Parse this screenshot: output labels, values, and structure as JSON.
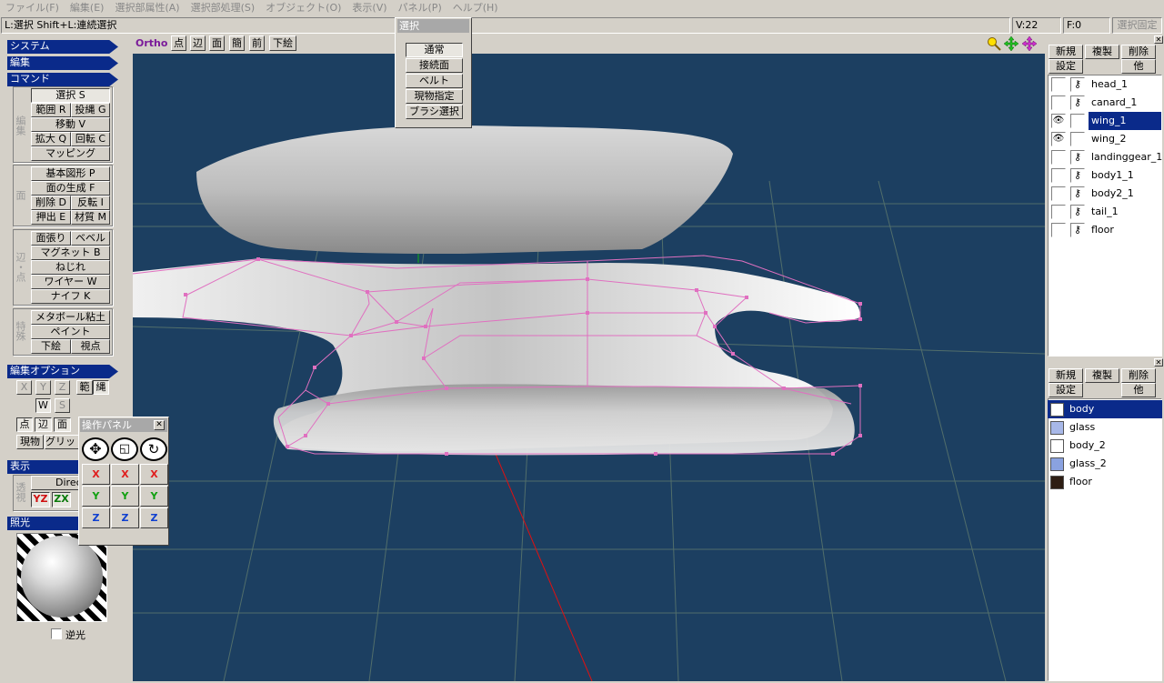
{
  "menu": [
    "ファイル(F)",
    "編集(E)",
    "選択部属性(A)",
    "選択部処理(S)",
    "オブジェクト(O)",
    "表示(V)",
    "パネル(P)",
    "ヘルプ(H)"
  ],
  "status": {
    "hint": "L:選択  Shift+L:連続選択",
    "vertices": "V:22",
    "faces": "F:0",
    "lock": "選択固定"
  },
  "sidebar": {
    "system": "システム",
    "edit": "編集",
    "command": "コマンド",
    "group_edit_label": "編集",
    "select": "選択 S",
    "range": "範囲 R",
    "lasso": "投縄 G",
    "move": "移動 V",
    "scale": "拡大 Q",
    "rotate": "回転 C",
    "mapping": "マッピング",
    "group_face_label": "面",
    "primitive": "基本図形 P",
    "face_gen": "面の生成 F",
    "delete": "削除 D",
    "flip": "反転 I",
    "extrude": "押出 E",
    "material": "材質 M",
    "group_vtx_label": "辺・点",
    "surface": "面張り",
    "bevel": "ベベル",
    "magnet": "マグネット B",
    "twist": "ねじれ",
    "wire": "ワイヤー W",
    "knife": "ナイフ K",
    "group_special_label": "特殊",
    "metaball": "メタボール粘土",
    "paint": "ペイント",
    "underlay": "下絵",
    "viewpoint": "視点",
    "edit_options": "編集オプション",
    "axes": [
      "X",
      "Y",
      "Z"
    ],
    "range2": "範",
    "lasso2": "縄",
    "w": "W",
    "s": "S",
    "pt": "点",
    "edge": "辺",
    "face": "面",
    "obj": "現物",
    "grid": "グリッド",
    "display": "表示",
    "direct": "Direct",
    "persp_label": "透視",
    "yz": "YZ",
    "zx": "ZX",
    "lighting": "照光",
    "backlight": "逆光"
  },
  "viewport": {
    "ortho": "Ortho",
    "pt": "点",
    "edge": "辺",
    "face": "面",
    "simple": "簡",
    "front": "前",
    "underlay": "下絵"
  },
  "select_panel": {
    "title": "選択",
    "items": [
      "通常",
      "接続面",
      "ベルト",
      "現物指定",
      "ブラシ選択"
    ]
  },
  "op_panel": {
    "title": "操作パネル",
    "x": "X",
    "y": "Y",
    "z": "Z"
  },
  "objects": {
    "new": "新規",
    "dup": "複製",
    "del": "削除",
    "settings": "設定",
    "other": "他",
    "items": [
      {
        "name": "head_1",
        "visible": false,
        "selected": false
      },
      {
        "name": "canard_1",
        "visible": false,
        "selected": false
      },
      {
        "name": "wing_1",
        "visible": true,
        "selected": true
      },
      {
        "name": "wing_2",
        "visible": true,
        "selected": false
      },
      {
        "name": "landinggear_1",
        "visible": false,
        "selected": false
      },
      {
        "name": "body1_1",
        "visible": false,
        "selected": false
      },
      {
        "name": "body2_1",
        "visible": false,
        "selected": false
      },
      {
        "name": "tail_1",
        "visible": false,
        "selected": false
      },
      {
        "name": "floor",
        "visible": false,
        "selected": false
      }
    ]
  },
  "materials": {
    "new": "新規",
    "dup": "複製",
    "del": "削除",
    "settings": "設定",
    "other": "他",
    "items": [
      {
        "name": "body",
        "color": "#ffffff",
        "selected": true
      },
      {
        "name": "glass",
        "color": "#a8b8e8",
        "selected": false
      },
      {
        "name": "body_2",
        "color": "#ffffff",
        "selected": false
      },
      {
        "name": "glass_2",
        "color": "#8aa2e0",
        "selected": false
      },
      {
        "name": "floor",
        "color": "#2e1e14",
        "selected": false
      }
    ]
  },
  "colors": {
    "accent": "#0a2a8a",
    "viewport_bg": "#1c3f61",
    "wire": "#e070c0"
  }
}
